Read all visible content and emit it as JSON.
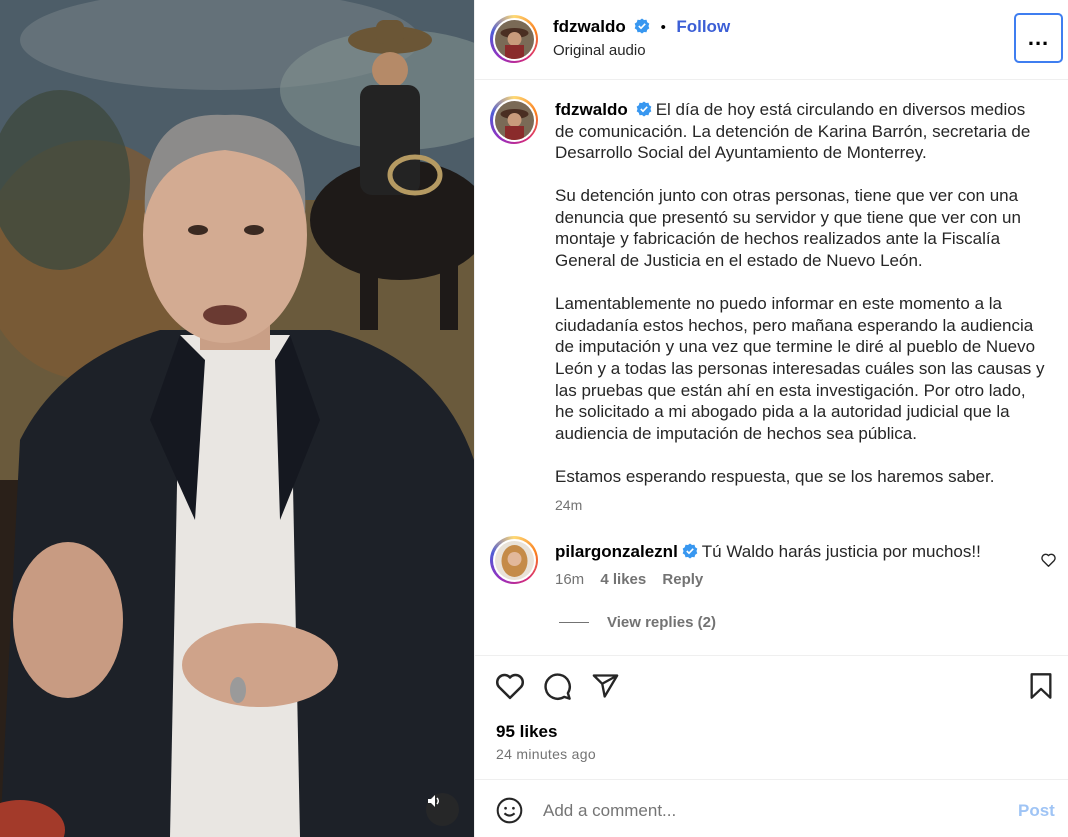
{
  "header": {
    "username": "fdzwaldo",
    "follow_label": "Follow",
    "subtitle": "Original audio",
    "more_label": "..."
  },
  "caption": {
    "username": "fdzwaldo",
    "paragraphs": [
      "El día de hoy está circulando en diversos medios de comunicación. La detención de Karina Barrón, secretaria de Desarrollo Social del Ayuntamiento de Monterrey.",
      "Su detención junto con otras personas, tiene que ver con una denuncia que presentó su servidor y que tiene que ver con un montaje y fabricación de hechos realizados ante la Fiscalía General de Justicia en el estado de Nuevo León.",
      "Lamentablemente no puedo informar en este momento a la ciudadanía estos hechos, pero mañana esperando la audiencia de imputación y una vez que termine le diré al pueblo de Nuevo León y a todas las personas interesadas cuáles son las causas y las pruebas que están ahí en esta investigación. Por otro lado, he solicitado a mi abogado pida a la autoridad judicial que la audiencia de imputación de hechos sea pública.",
      "Estamos esperando respuesta, que se los haremos saber."
    ],
    "time": "24m"
  },
  "comment": {
    "username": "pilargonzaleznl",
    "text": "Tú Waldo harás justicia por muchos!!",
    "time": "16m",
    "likes": "4 likes",
    "reply_label": "Reply",
    "view_replies": "View replies (2)"
  },
  "post": {
    "likes": "95 likes",
    "time_ago": "24 minutes ago"
  },
  "add_comment": {
    "placeholder": "Add a comment...",
    "post_label": "Post"
  },
  "colors": {
    "accent": "#3c5fd6",
    "verified": "#3897f0",
    "post_disabled": "#9fc4f5",
    "focus_ring": "#3f7ef0"
  },
  "icons": [
    "verified-badge-icon",
    "more-options-icon",
    "heart-icon",
    "comment-icon",
    "share-icon",
    "bookmark-icon",
    "emoji-icon",
    "audio-icon"
  ]
}
